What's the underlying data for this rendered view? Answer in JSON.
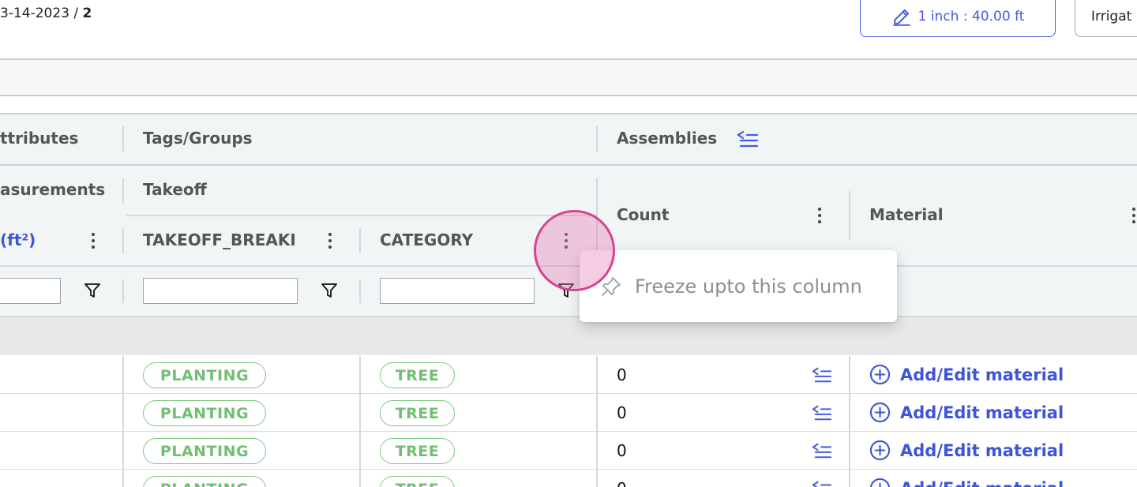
{
  "header": {
    "breadcrumb_date": "3-14-2023 / ",
    "breadcrumb_page": "2",
    "scale_label": "1 inch : 40.00 ft",
    "layer_label": "Irrigat"
  },
  "grid": {
    "group_headers": [
      "ttributes",
      "Tags/Groups",
      "Assemblies"
    ],
    "sub_headers": [
      "asurements",
      "Takeoff"
    ],
    "column_headers": {
      "area": "(ft²)",
      "takeoff_breakdown": "TAKEOFF_BREAKI",
      "category": "CATEGORY",
      "count": "Count",
      "material": "Material"
    },
    "rows": [
      {
        "takeoff": "PLANTING",
        "category": "TREE",
        "count": "0",
        "material_action": "Add/Edit material"
      },
      {
        "takeoff": "PLANTING",
        "category": "TREE",
        "count": "0",
        "material_action": "Add/Edit material"
      },
      {
        "takeoff": "PLANTING",
        "category": "TREE",
        "count": "0",
        "material_action": "Add/Edit material"
      },
      {
        "takeoff": "PLANTING",
        "category": "TREE",
        "count": "0",
        "material_action": "Add/Edit material"
      }
    ]
  },
  "popup": {
    "freeze_label": "Freeze upto this column"
  },
  "colors": {
    "accent": "#4759e4",
    "pill_green": "#72be72",
    "highlight": "#d6438f"
  }
}
